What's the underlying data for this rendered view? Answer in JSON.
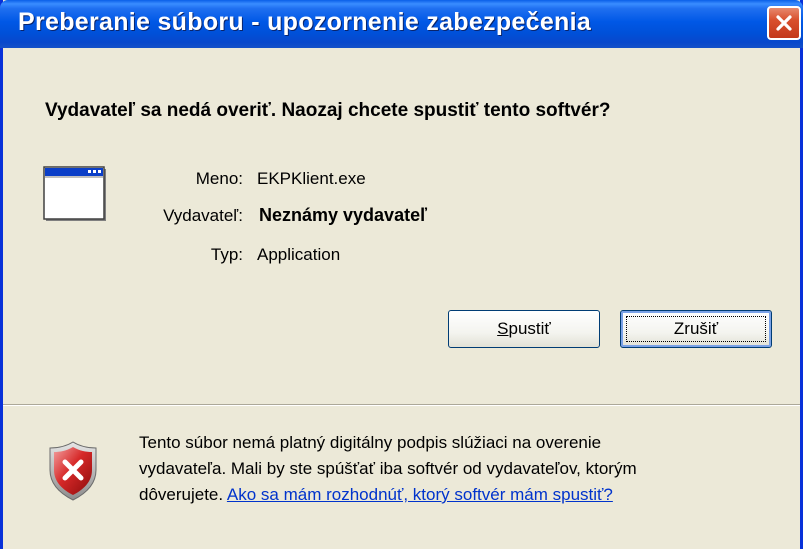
{
  "window": {
    "title": "Preberanie súboru - upozornenie zabezpečenia",
    "heading": "Vydavateľ sa nedá overiť. Naozaj chcete spustiť tento softvér?"
  },
  "details": {
    "name_label": "Meno:",
    "name_value": "EKPKlient.exe",
    "publisher_label": "Vydavateľ:",
    "publisher_value": "Neznámy vydavateľ",
    "type_label": "Typ:",
    "type_value": "Application"
  },
  "buttons": {
    "run_mnemonic": "S",
    "run_rest": "pustiť",
    "cancel_label": "Zrušiť"
  },
  "footer": {
    "line1": "Tento súbor nemá platný digitálny podpis slúžiaci na overenie",
    "line2": "vydavateľa. Mali by ste spúšťať iba softvér od vydavateľov, ktorým",
    "line3_prefix": "dôverujete. ",
    "link_text": "Ako sa mám rozhodnúť, ktorý softvér mám spustiť?"
  },
  "colors": {
    "titlebar": "#0058e6",
    "window_bg": "#ece9d8",
    "close_button": "#d9502e",
    "link": "#0033cc"
  },
  "icons": [
    "application-window-icon",
    "security-shield-icon",
    "close-icon"
  ]
}
